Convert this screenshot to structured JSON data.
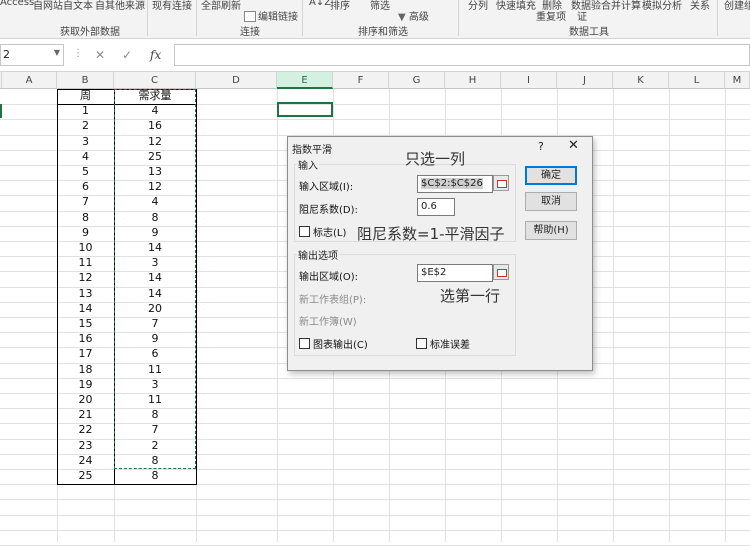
{
  "ribbon": {
    "top_items": [
      "Access",
      "自网站",
      "自文本",
      "自其他来源",
      "现有连接",
      "全部刷新",
      "排序",
      "筛选",
      "分列",
      "快速填充",
      "删除",
      "数据验",
      "合并计算",
      "模拟分析",
      "关系",
      "创建组"
    ],
    "edit_links": "编辑链接",
    "advanced": "高级",
    "second_row": [
      "重复项",
      "证"
    ],
    "groups": [
      "获取外部数据",
      "连接",
      "排序和筛选",
      "数据工具"
    ]
  },
  "formula_bar": {
    "name_box": "2",
    "cancel": "✕",
    "enter": "✓",
    "fx": "fx",
    "formula": ""
  },
  "columns": [
    "A",
    "B",
    "C",
    "D",
    "E",
    "F",
    "G",
    "H",
    "I",
    "J",
    "K",
    "L",
    "M"
  ],
  "selected_column": "E",
  "table": {
    "headers": [
      "周",
      "需求量"
    ],
    "rows": [
      [
        "1",
        "4"
      ],
      [
        "2",
        "16"
      ],
      [
        "3",
        "12"
      ],
      [
        "4",
        "25"
      ],
      [
        "5",
        "13"
      ],
      [
        "6",
        "12"
      ],
      [
        "7",
        "4"
      ],
      [
        "8",
        "8"
      ],
      [
        "9",
        "9"
      ],
      [
        "10",
        "14"
      ],
      [
        "11",
        "3"
      ],
      [
        "12",
        "14"
      ],
      [
        "13",
        "14"
      ],
      [
        "14",
        "20"
      ],
      [
        "15",
        "7"
      ],
      [
        "16",
        "9"
      ],
      [
        "17",
        "6"
      ],
      [
        "18",
        "11"
      ],
      [
        "19",
        "3"
      ],
      [
        "20",
        "11"
      ],
      [
        "21",
        "8"
      ],
      [
        "22",
        "7"
      ],
      [
        "23",
        "2"
      ],
      [
        "24",
        "8"
      ],
      [
        "25",
        "8"
      ]
    ]
  },
  "dialog": {
    "title": "指数平滑",
    "help": "?",
    "close": "✕",
    "input_group": "输入",
    "input_range_label": "输入区域(I):",
    "input_range_value": "$C$2:$C$26",
    "damping_label": "阻尼系数(D):",
    "damping_value": "0.6",
    "labels_label": "标志(L)",
    "output_group": "输出选项",
    "output_range_label": "输出区域(O):",
    "output_range_value": "$E$2",
    "new_sheet_label": "新工作表组(P):",
    "new_workbook_label": "新工作簿(W)",
    "chart_output_label": "图表输出(C)",
    "std_error_label": "标准误差",
    "ok": "确定",
    "cancel": "取消",
    "help_button": "帮助(H)"
  },
  "annotations": {
    "select_one_column": "只选一列",
    "damping_formula": "阻尼系数=1-平滑因子",
    "first_row": "选第一行"
  }
}
